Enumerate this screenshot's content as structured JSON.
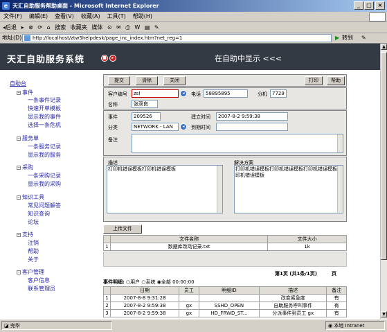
{
  "window": {
    "title": "天汇自助服务帮助桌面 - Microsoft Internet Explorer",
    "min": "_",
    "max": "□",
    "close": "×"
  },
  "menu": [
    "文件(F)",
    "编辑(E)",
    "查看(V)",
    "收藏(A)",
    "工具(T)",
    "帮助(H)"
  ],
  "toolbar": {
    "back": "◂后退",
    "forward": "▸",
    "stop": "⊗",
    "refresh": "⟳",
    "home": "⌂",
    "search": "搜索",
    "favorites": "收藏夹",
    "media": "媒体",
    "history": "⊙",
    "mail": "✉",
    "print": "⎙",
    "edit": "W",
    "discuss": "▤",
    "messenger": "✎"
  },
  "address": {
    "label": "地址(D)",
    "url": "http://localhost/ztw5helpdesk/page_inc_index.htm?net_reg=1",
    "go": "转到",
    "links": "✎"
  },
  "header": {
    "title": "天汇自助服务系统",
    "marquee": "在自助中显示 <<<",
    "stop_icon": "■",
    "play_icon": "▸"
  },
  "sidebar": {
    "root": "自助台",
    "sections": [
      {
        "title": "事件",
        "toggle": "−",
        "items": [
          "一条事件记录",
          "快速开单模板",
          "显示我的事件",
          "选择一条危机"
        ]
      },
      {
        "title": "服务单",
        "toggle": "−",
        "items": [
          "一条服务记录",
          "显示我的服务"
        ]
      },
      {
        "title": "采购",
        "toggle": "−",
        "items": [
          "一条采购记录",
          "显示我的采购"
        ]
      },
      {
        "title": "知识工具",
        "toggle": "−",
        "items": [
          "常见问题解答",
          "知识查询",
          "论坛"
        ]
      },
      {
        "title": "支持",
        "toggle": "−",
        "items": [
          "注销",
          "帮助",
          "关于"
        ]
      },
      {
        "title": "客户管理",
        "toggle": "−",
        "items": [
          "客户信息",
          "联系管理员"
        ]
      }
    ]
  },
  "form": {
    "buttons": {
      "submit": "提交",
      "clear": "清除",
      "close": "关闭",
      "print": "打印",
      "help": "帮助"
    },
    "customer_id_label": "客户编号",
    "customer_id": "zsl",
    "phone_label": "电话",
    "phone": "58895895",
    "ext_label": "分机",
    "ext": "7729",
    "name_label": "名称",
    "name": "张双良",
    "event_label": "事件",
    "event": "209526",
    "created_label": "建立时间",
    "created": "2007-8-2 9:59:38",
    "category_label": "分类",
    "category": "NETWORK - LAN",
    "arrival_label": "到期时间",
    "arrival": "",
    "note_label": "备注",
    "note": "",
    "desc_label": "描述",
    "desc": "打印机错误模板打印机错误模板",
    "solution_label": "解决方案",
    "solution": "打印机错误模板打印机错误模板打印机错误模板打印机错误模板",
    "upload": "上传文件",
    "search_icon": "◂"
  },
  "files": {
    "headers": [
      "",
      "文件名称",
      "文件大小"
    ],
    "rows": [
      [
        "1",
        "数据库改动记录.txt",
        "1k"
      ]
    ]
  },
  "pager": {
    "text": "第1页 (共1条/1页)",
    "suffix": "页"
  },
  "events": {
    "filter_label": "事件明细:",
    "options": [
      "用户",
      "系统",
      "全部"
    ],
    "selected": "全部",
    "time": "00:00:00",
    "headers": [
      "",
      "日期",
      "员工",
      "明细ID",
      "描述",
      "备注"
    ],
    "rows": [
      [
        "1",
        "2007-8-8 9:31:28",
        "",
        "",
        "改变紧急度",
        "有"
      ],
      [
        "2",
        "2007-8-2 9:59:38",
        "gx",
        "SSHD_OPEN",
        "自助服务呼叫事件",
        "有"
      ],
      [
        "3",
        "2007-8-2 9:59:38",
        "gx",
        "HD_FRWD_ST...",
        "分派事件到员工 gx",
        "有"
      ]
    ]
  },
  "status": {
    "text": "完毕",
    "zone": "本地 Intranet"
  }
}
